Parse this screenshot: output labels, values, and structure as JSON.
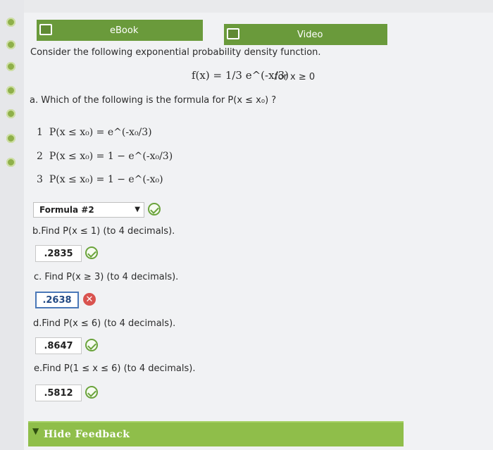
{
  "header": {
    "ebook_label": "eBook",
    "video_label": "Video"
  },
  "question": {
    "intro": "Consider the following exponential probability density function.",
    "function_formula": "f(x) = 1/3 e^(-x/3)",
    "condition": "for  x ≥ 0",
    "part_a": "a. Which of the following is the formula for P(x ≤ x₀) ?",
    "options": [
      {
        "num": "1",
        "formula": "P(x ≤ x₀) = e^(-x₀/3)"
      },
      {
        "num": "2",
        "formula": "P(x ≤ x₀) = 1 − e^(-x₀/3)"
      },
      {
        "num": "3",
        "formula": "P(x ≤ x₀) = 1 − e^(-x₀)"
      }
    ],
    "select_value": "Formula #2",
    "part_b": "b.Find P(x ≤ 1) (to 4 decimals).",
    "answer_b": ".2835",
    "part_c": "c. Find P(x ≥ 3) (to 4 decimals).",
    "answer_c": ".2638",
    "part_d": "d.Find P(x ≤ 6) (to 4 decimals).",
    "answer_d": ".8647",
    "part_e": "e.Find P(1 ≤ x ≤ 6) (to 4 decimals).",
    "answer_e": ".5812"
  },
  "feedback": {
    "label": "Hide Feedback"
  },
  "colors": {
    "tab_green": "#6a9a3b",
    "correct_green": "#6aa33b",
    "wrong_red": "#d9534f",
    "feedback_green": "#8fbe4a"
  }
}
